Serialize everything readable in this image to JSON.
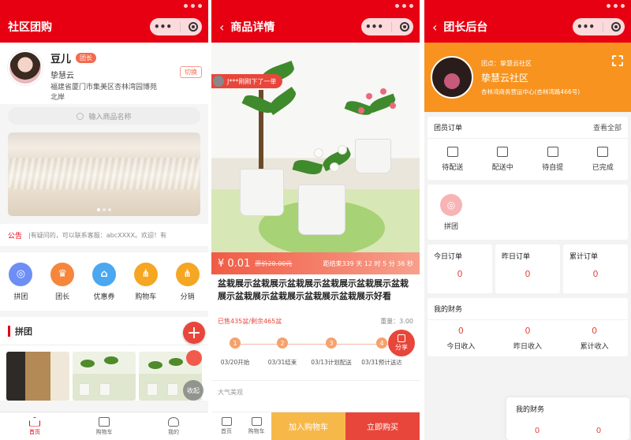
{
  "screen1": {
    "title": "社区团购",
    "profile": {
      "name": "豆儿",
      "badge": "团长",
      "community": "挚慧云",
      "address": "福建省厦门市集美区杏林湾园博苑北岸",
      "switch_label": "切换"
    },
    "search_placeholder": "输入商品名称",
    "notice": {
      "tag": "公告",
      "text": "|有疑问的，可以联系客服：abcXXXX。欢迎！有"
    },
    "grid": [
      {
        "label": "拼团",
        "color": "#6c8ef5"
      },
      {
        "label": "团长",
        "color": "#f5863b"
      },
      {
        "label": "优惠券",
        "color": "#4aa7f0"
      },
      {
        "label": "购物车",
        "color": "#f5a623"
      },
      {
        "label": "分销",
        "color": "#f5a623"
      }
    ],
    "section_title": "拼团",
    "collapse_label": "收起",
    "tabs": [
      {
        "label": "首页",
        "active": true
      },
      {
        "label": "购物车",
        "active": false
      },
      {
        "label": "我的",
        "active": false
      }
    ]
  },
  "screen2": {
    "title": "商品详情",
    "buyer_tip": "J***刚刚下了一单",
    "price": "¥ 0.01",
    "original_price": "原价20.00元",
    "countdown": "距结束339 天 12 时 5 分 36 秒",
    "product_title": "盆栽展示盆栽展示盆栽展示盆栽展示盆栽展示盆栽展示盆栽展示盆栽展示盆栽展示盆栽展示好看",
    "sold": "已售435盆/剩余465盆",
    "stock": "重量：3.00",
    "timeline": [
      {
        "num": "1",
        "label": "03/20开始"
      },
      {
        "num": "2",
        "label": "03/31结束"
      },
      {
        "num": "3",
        "label": "03/13计划配送"
      },
      {
        "num": "4",
        "label": "03/31预计送达"
      }
    ],
    "share_label": "分享",
    "desc": "大气美观",
    "bottom": {
      "home": "首页",
      "cart": "购物车",
      "add_cart": "加入购物车",
      "buy_now": "立即购买"
    }
  },
  "screen3": {
    "title": "团长后台",
    "community": "团点：挚慧云社区",
    "name": "挚慧云社区",
    "address": "杏林湾商务营运中心(杏林湾路466号)",
    "orders": {
      "title": "团员订单",
      "more": "查看全部",
      "items": [
        "待配送",
        "配送中",
        "待自提",
        "已完成"
      ]
    },
    "pintuan_label": "拼团",
    "stats": [
      {
        "label": "今日订单",
        "value": "0"
      },
      {
        "label": "昨日订单",
        "value": "0"
      },
      {
        "label": "累计订单",
        "value": "0"
      }
    ],
    "finance": {
      "title": "我的财务",
      "items": [
        {
          "label": "今日收入",
          "value": "0"
        },
        {
          "label": "昨日收入",
          "value": "0"
        },
        {
          "label": "累计收入",
          "value": "0"
        }
      ]
    },
    "overlay": {
      "title": "我的财务",
      "values": [
        "0",
        "0"
      ]
    }
  }
}
